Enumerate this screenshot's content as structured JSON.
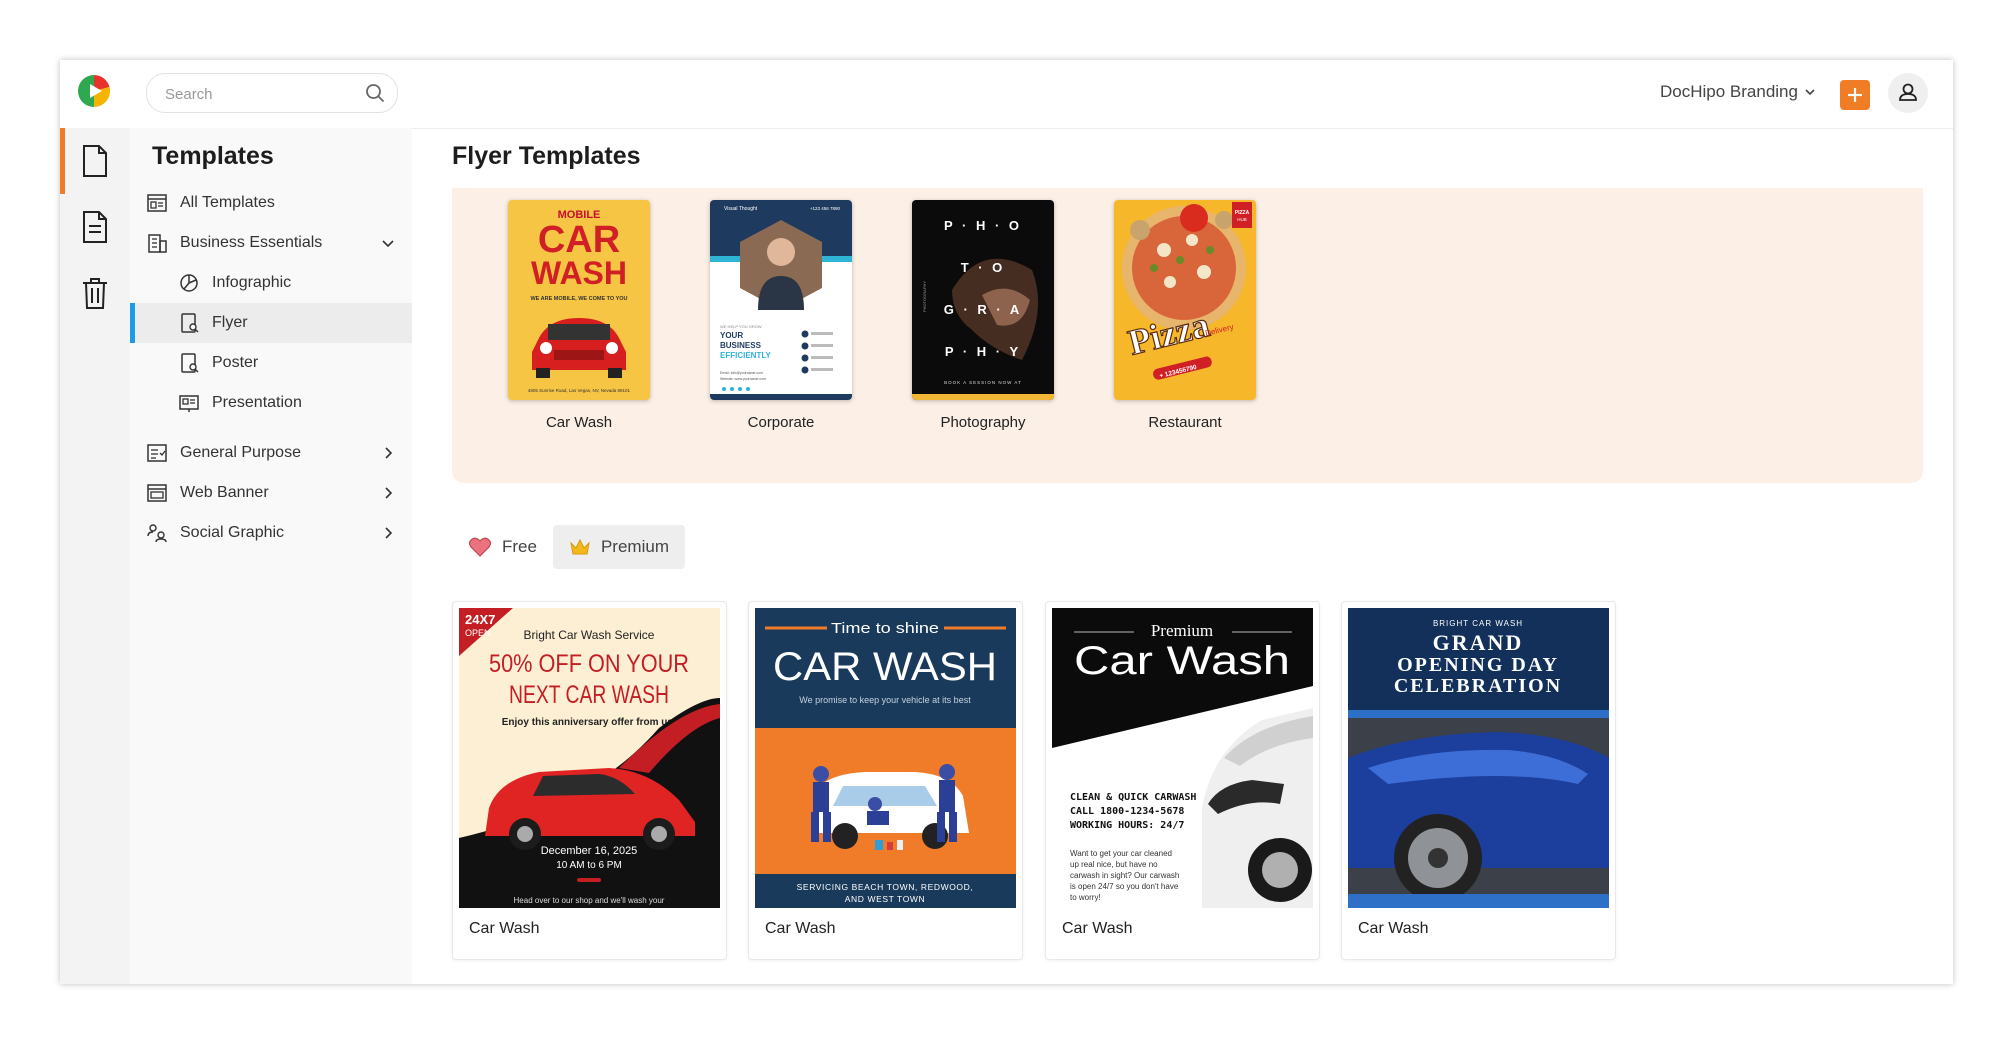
{
  "header": {
    "search_placeholder": "Search",
    "brand_label": "DocHipo Branding"
  },
  "sidebar": {
    "title": "Templates",
    "items": [
      {
        "label": "All Templates"
      },
      {
        "label": "Business Essentials"
      },
      {
        "label": "Infographic"
      },
      {
        "label": "Flyer"
      },
      {
        "label": "Poster"
      },
      {
        "label": "Presentation"
      },
      {
        "label": "General Purpose"
      },
      {
        "label": "Web Banner"
      },
      {
        "label": "Social Graphic"
      }
    ]
  },
  "main": {
    "title": "Flyer Templates",
    "categories": [
      {
        "label": "Car Wash",
        "thumb": {
          "line1": "MOBILE",
          "line2": "CAR",
          "line3": "WASH",
          "tagline": "WE ARE MOBILE, WE COME TO YOU",
          "address": "4805 Sunrise Road, Las Vegas, NV, Nevada 89101"
        }
      },
      {
        "label": "Corporate",
        "thumb": {
          "company": "Visual Thought",
          "phone": "+123 456 7890",
          "headline1": "YOUR",
          "headline2": "BUSINESS",
          "headline3": "EFFICIENTLY",
          "kicker": "WE HELP YOU GROW",
          "email": "Email: info@yourname.com",
          "website": "Website: www.yourname.com"
        }
      },
      {
        "label": "Photography",
        "thumb": {
          "row1": "P · H · O",
          "row2": "T · O",
          "row3": "G · R · A",
          "row4": "P · H · Y",
          "side": "PHOTOGRAPHY",
          "cta": "BOOK A SESSION NOW AT"
        }
      },
      {
        "label": "Restaurant",
        "thumb": {
          "word": "Pizza",
          "sub": "Delivery",
          "badge_line1": "PIZZA",
          "badge_line2": "HUB",
          "phone": "+ 123456790"
        }
      }
    ],
    "filters": [
      {
        "label": "Free"
      },
      {
        "label": "Premium"
      }
    ],
    "cards": [
      {
        "label": "Car Wash",
        "art": {
          "corner1": "24X7",
          "corner2": "OPEN",
          "service": "Bright Car Wash Service",
          "headline1": "50% OFF ON YOUR",
          "headline2": "NEXT CAR WASH",
          "subline": "Enjoy this anniversary offer from us!",
          "date": "December 16, 2025",
          "time": "10 AM to 6 PM",
          "footer": "Head over to our shop and we'll wash your"
        }
      },
      {
        "label": "Car Wash",
        "art": {
          "top": "Time to shine",
          "title": "CAR WASH",
          "subtitle": "We promise to keep your vehicle at its best",
          "footer1": "SERVICING BEACH TOWN, REDWOOD,",
          "footer2": "AND WEST TOWN"
        }
      },
      {
        "label": "Car Wash",
        "art": {
          "top": "Premium",
          "title": "Car Wash",
          "line1": "CLEAN & QUICK CARWASH",
          "line2": "CALL 1800-1234-5678",
          "line3": "WORKING HOURS: 24/7",
          "para1": "Want to get your car cleaned",
          "para2": "up real nice, but have no",
          "para3": "carwash in sight? Our carwash",
          "para4": "is open 24/7 so you don't have",
          "para5": "to worry!"
        }
      },
      {
        "label": "Car Wash",
        "art": {
          "top": "BRIGHT CAR WASH",
          "line1": "GRAND",
          "line2": "OPENING DAY",
          "line3": "CELEBRATION"
        }
      }
    ]
  },
  "colors": {
    "accent": "#f07c26",
    "selected_bar": "#1e9be8",
    "panel_bg": "#fbefe6"
  },
  "icons": [
    "logo-icon",
    "search-icon",
    "chevron-down-icon",
    "plus-icon",
    "user-icon",
    "document-icon",
    "page-icon",
    "trash-icon",
    "all-templates-icon",
    "business-icon",
    "infographic-icon",
    "flyer-icon",
    "poster-icon",
    "presentation-icon",
    "general-purpose-icon",
    "web-banner-icon",
    "social-graphic-icon",
    "chevron-right-icon",
    "heart-icon",
    "crown-icon"
  ]
}
